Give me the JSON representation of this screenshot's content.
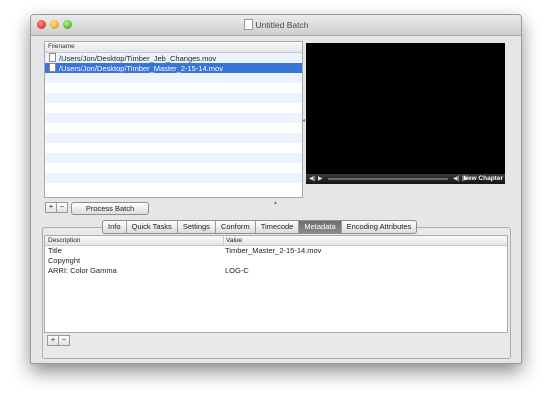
{
  "window": {
    "title": "Untitled Batch"
  },
  "file_list": {
    "header": "Filename",
    "rows": [
      {
        "path": "/Users/Jon/Desktop/Timber_Jeb_Changes.mov",
        "selected": false
      },
      {
        "path": "/Users/Jon/Desktop/Timber_Master_2-15-14.mov",
        "selected": true
      }
    ]
  },
  "file_buttons": {
    "add": "+",
    "remove": "−",
    "process": "Process Batch"
  },
  "player": {
    "new_chapter": "New Chapter"
  },
  "tabs": [
    {
      "label": "Info"
    },
    {
      "label": "Quick Tasks"
    },
    {
      "label": "Settings"
    },
    {
      "label": "Conform"
    },
    {
      "label": "Timecode"
    },
    {
      "label": "Metadata",
      "active": true
    },
    {
      "label": "Encoding Attributes"
    }
  ],
  "metadata": {
    "headers": {
      "description": "Description",
      "value": "Value"
    },
    "rows": [
      {
        "description": "Title",
        "value": "Timber_Master_2-15-14.mov"
      },
      {
        "description": "Copyright",
        "value": ""
      },
      {
        "description": "ARRI: Color Gamma",
        "value": "LOG-C"
      }
    ]
  },
  "metadata_buttons": {
    "add": "+",
    "remove": "−"
  }
}
